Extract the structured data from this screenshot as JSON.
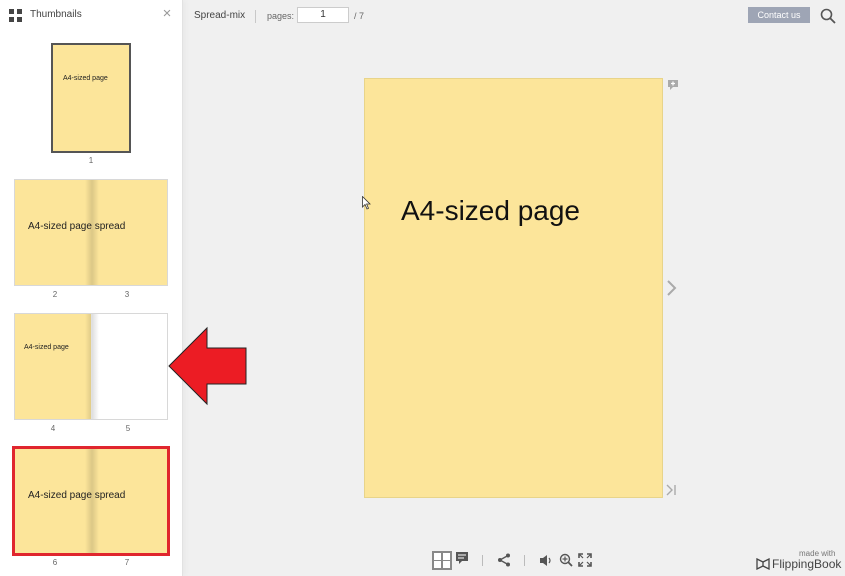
{
  "sidebar": {
    "title": "Thumbnails",
    "close_glyph": "×",
    "thumbnails": [
      {
        "text": "A4-sized page",
        "pages": [
          "1"
        ],
        "selected": false
      },
      {
        "text": "A4-sized page spread",
        "pages": [
          "2",
          "3"
        ],
        "selected": false
      },
      {
        "text": "A4-sized page",
        "pages": [
          "4",
          "5"
        ],
        "selected": false
      },
      {
        "text": "A4-sized page spread",
        "pages": [
          "6",
          "7"
        ],
        "selected": true
      }
    ]
  },
  "toolbar": {
    "publication_title": "Spread-mix",
    "pages_label": "pages:",
    "current_page": "1",
    "total_pages": "/ 7",
    "contact_label": "Contact us"
  },
  "main": {
    "page_text": "A4-sized page"
  },
  "footer": {
    "made_with": "made with",
    "brand": "FlippingBook"
  },
  "colors": {
    "page": "#fce59a",
    "highlight": "#e0262e",
    "contact_button": "#9ea5b5",
    "background": "#f0f0f0"
  },
  "icons": [
    "grid-icon",
    "close-icon",
    "search-icon",
    "comment-icon",
    "chevron-right-icon",
    "last-page-icon",
    "thumbnails-icon",
    "notes-icon",
    "share-icon",
    "sound-icon",
    "zoom-in-icon",
    "fullscreen-icon",
    "flippingbook-logo-icon",
    "red-arrow-icon"
  ]
}
